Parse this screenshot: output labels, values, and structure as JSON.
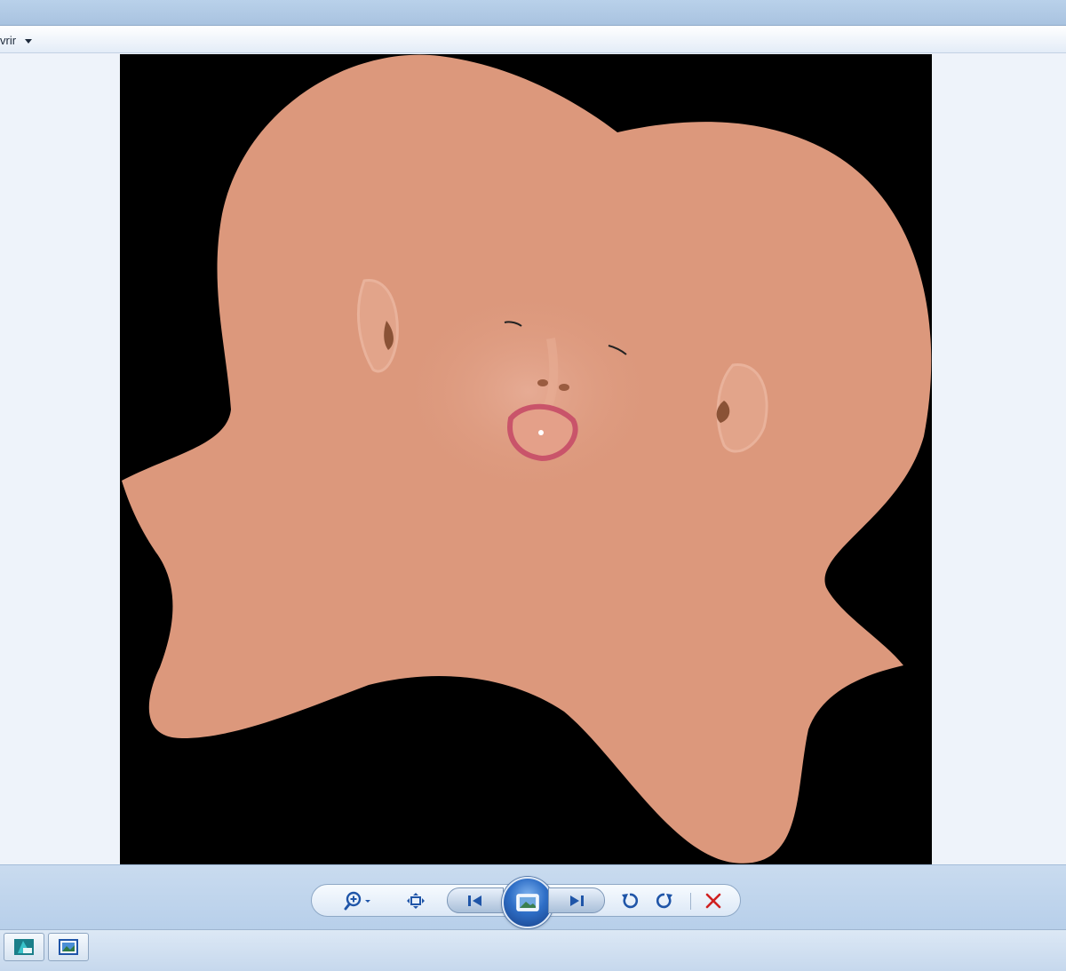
{
  "menubar": {
    "open_label": "vrir"
  },
  "viewer": {
    "photo_description_icon": "face-texture-map-image"
  },
  "controls": {
    "zoom_icon": "zoom-icon",
    "fit_icon": "actual-size-icon",
    "previous_icon": "previous-icon",
    "slideshow_icon": "slideshow-icon",
    "next_icon": "next-icon",
    "rotate_ccw_icon": "rotate-counterclockwise-icon",
    "rotate_cw_icon": "rotate-clockwise-icon",
    "delete_icon": "delete-icon"
  },
  "taskbar": {
    "items": [
      {
        "icon": "app-icon"
      },
      {
        "icon": "photo-viewer-icon"
      }
    ]
  },
  "colors": {
    "skin": "#dc987c",
    "photo_background": "#000000",
    "lips": "#c9546a",
    "delete_red": "#d02020",
    "control_blue": "#1f55a8"
  }
}
